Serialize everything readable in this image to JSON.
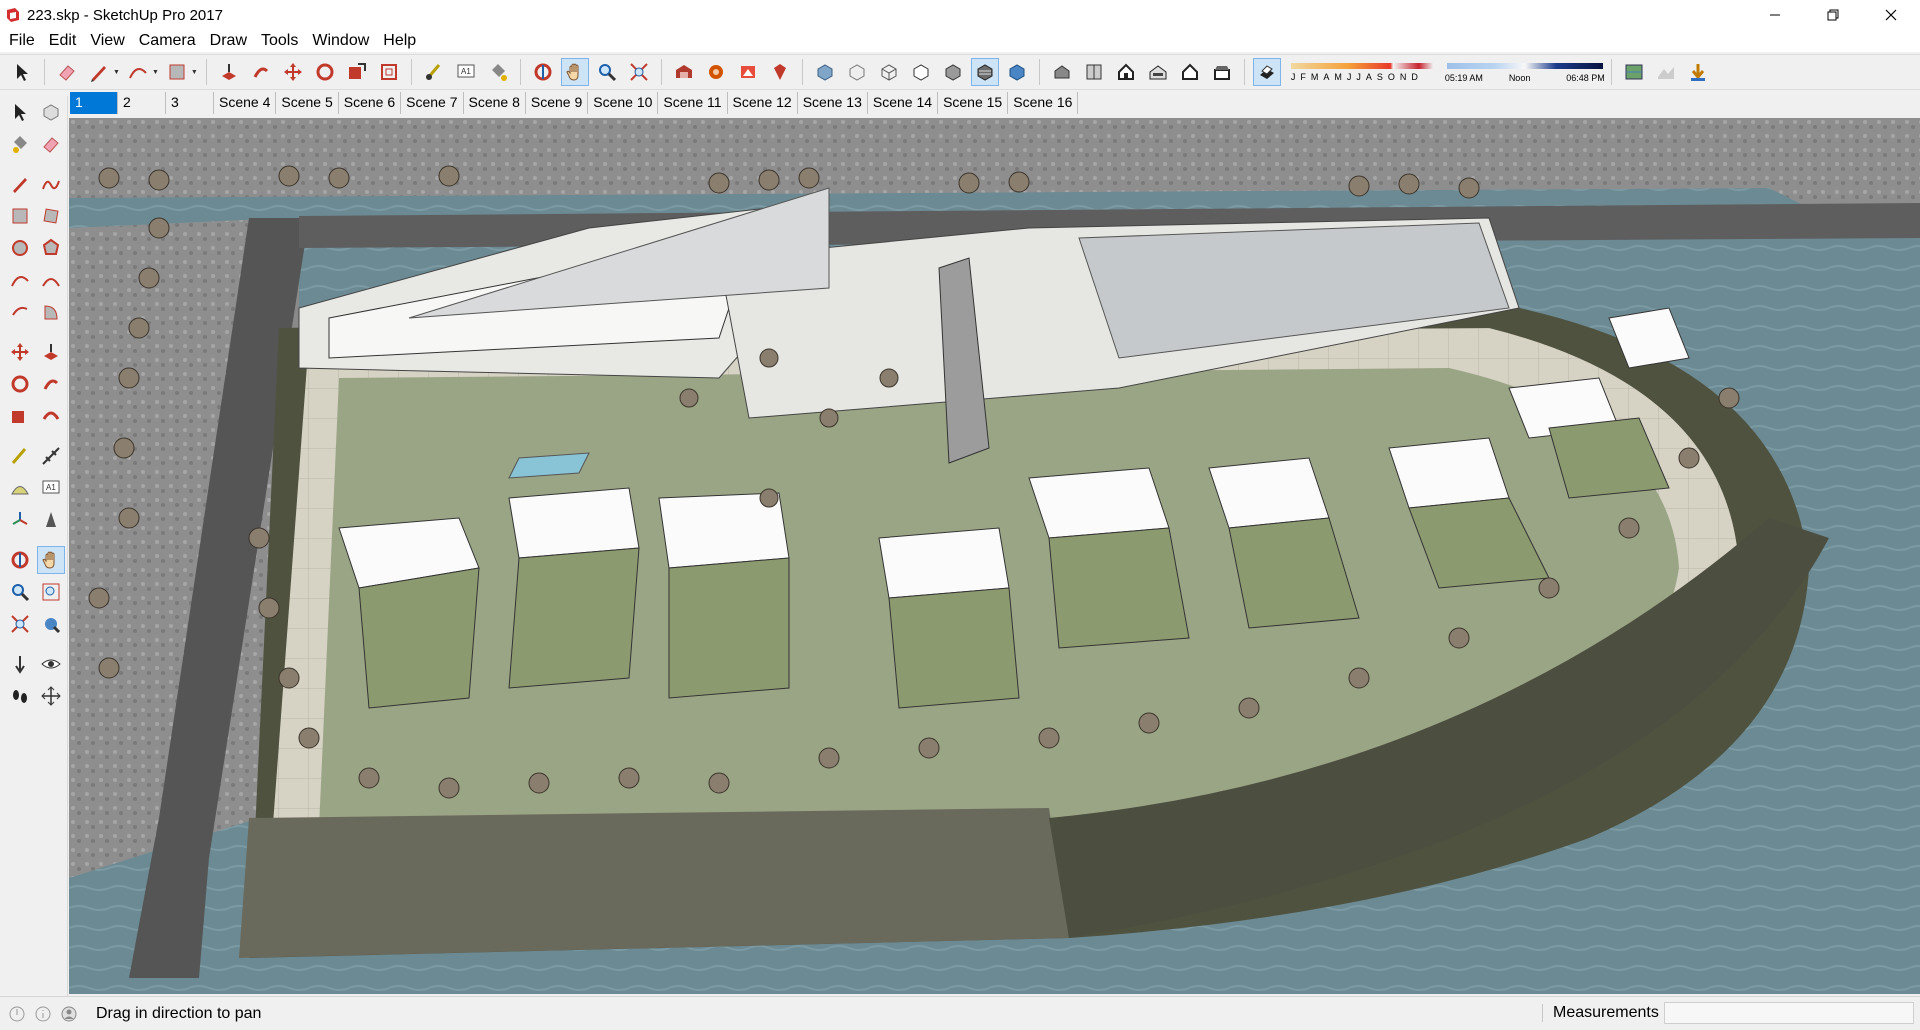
{
  "app": {
    "window_title": "223.skp - SketchUp Pro 2017"
  },
  "menu": [
    "File",
    "Edit",
    "View",
    "Camera",
    "Draw",
    "Tools",
    "Window",
    "Help"
  ],
  "shadow": {
    "months": [
      "J",
      "F",
      "M",
      "A",
      "M",
      "J",
      "J",
      "A",
      "S",
      "O",
      "N",
      "D"
    ],
    "time_start": "05:19 AM",
    "time_mid": "Noon",
    "time_end": "06:48 PM"
  },
  "scenes": [
    "1",
    "2",
    "3",
    "Scene 4",
    "Scene 5",
    "Scene 6",
    "Scene 7",
    "Scene 8",
    "Scene 9",
    "Scene 10",
    "Scene 11",
    "Scene 12",
    "Scene 13",
    "Scene 14",
    "Scene 15",
    "Scene 16"
  ],
  "active_scene": "1",
  "status": {
    "message": "Drag in direction to pan",
    "measurements_label": "Measurements",
    "measurements_value": ""
  },
  "colors": {
    "water": "#6c8a93",
    "ground": "#9a9a9a",
    "road": "#5a5a5a",
    "lawn": "#8b9a72",
    "accent_selected": "#0078d7"
  },
  "active_tool": "pan-tool"
}
